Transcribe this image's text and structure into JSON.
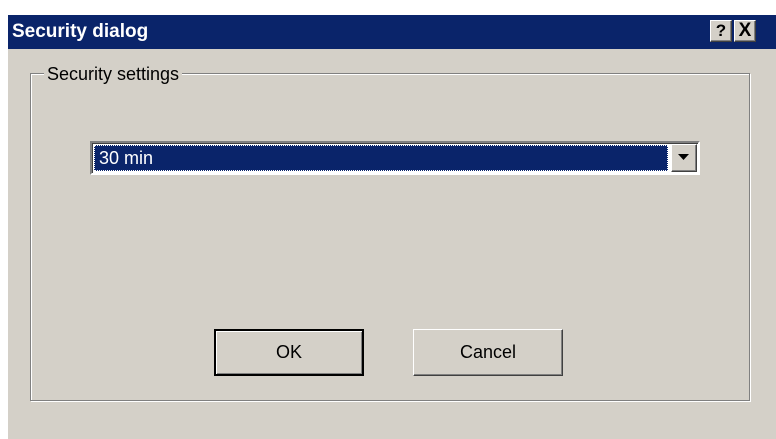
{
  "dialog": {
    "title": "Security dialog",
    "help_label": "?",
    "close_label": "X"
  },
  "group": {
    "label": "Security settings"
  },
  "timeout_select": {
    "selected": "30 min"
  },
  "buttons": {
    "ok_label": "OK",
    "cancel_label": "Cancel"
  },
  "colors": {
    "titlebar": "#0a246a",
    "face": "#d4d0c8",
    "selection": "#0a246a"
  },
  "icons": {
    "help": "question-mark-icon",
    "close": "close-icon",
    "dropdown": "chevron-down-icon"
  }
}
